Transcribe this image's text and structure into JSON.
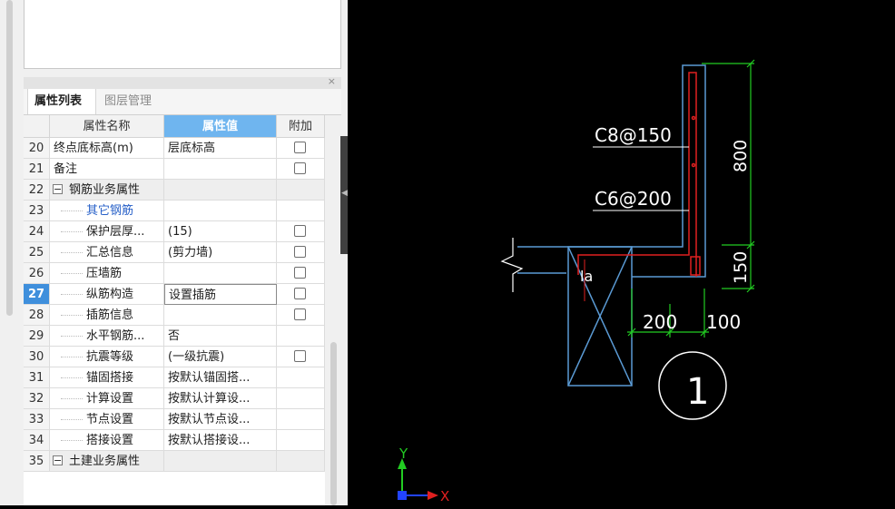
{
  "panel": {
    "close_glyph": "×",
    "tabs": [
      {
        "label": "属性列表"
      },
      {
        "label": "图层管理"
      }
    ],
    "columns": {
      "num": "",
      "name": "属性名称",
      "value": "属性值",
      "extra": "附加"
    },
    "rows": [
      {
        "num": "20",
        "name": "终点底标高(m)",
        "value": "层底标高",
        "checkbox": true
      },
      {
        "num": "21",
        "name": "备注",
        "value": "",
        "checkbox": true
      },
      {
        "num": "22",
        "name": "钢筋业务属性",
        "value": "",
        "checkbox": false,
        "group": true
      },
      {
        "num": "23",
        "name": "其它钢筋",
        "value": "",
        "checkbox": false,
        "link": true
      },
      {
        "num": "24",
        "name": "保护层厚...",
        "value": "(15)",
        "checkbox": true
      },
      {
        "num": "25",
        "name": "汇总信息",
        "value": "(剪力墙)",
        "checkbox": true
      },
      {
        "num": "26",
        "name": "压墙筋",
        "value": "",
        "checkbox": true
      },
      {
        "num": "27",
        "name": "纵筋构造",
        "value": "设置插筋",
        "checkbox": true,
        "selected": true
      },
      {
        "num": "28",
        "name": "插筋信息",
        "value": "",
        "checkbox": true
      },
      {
        "num": "29",
        "name": "水平钢筋...",
        "value": "否",
        "checkbox": false
      },
      {
        "num": "30",
        "name": "抗震等级",
        "value": "(一级抗震)",
        "checkbox": true
      },
      {
        "num": "31",
        "name": "锚固搭接",
        "value": "按默认锚固搭...",
        "checkbox": false
      },
      {
        "num": "32",
        "name": "计算设置",
        "value": "按默认计算设...",
        "checkbox": false
      },
      {
        "num": "33",
        "name": "节点设置",
        "value": "按默认节点设...",
        "checkbox": false
      },
      {
        "num": "34",
        "name": "搭接设置",
        "value": "按默认搭接设...",
        "checkbox": false
      },
      {
        "num": "35",
        "name": "土建业务属性",
        "value": "",
        "checkbox": false,
        "group": true
      }
    ]
  },
  "cad": {
    "labels": {
      "upper_rebar": "C8@150",
      "lower_rebar": "C6@200",
      "anchor": "la",
      "height_top": "800",
      "height_bottom": "150",
      "width_left": "200",
      "width_right": "100",
      "section_no": "1"
    },
    "axis": {
      "y": "Y",
      "x": "X"
    },
    "colors": {
      "wall": "#5b9bd5",
      "rebar": "#e02020",
      "dimension": "#22cc22",
      "text": "#ffffff"
    }
  }
}
